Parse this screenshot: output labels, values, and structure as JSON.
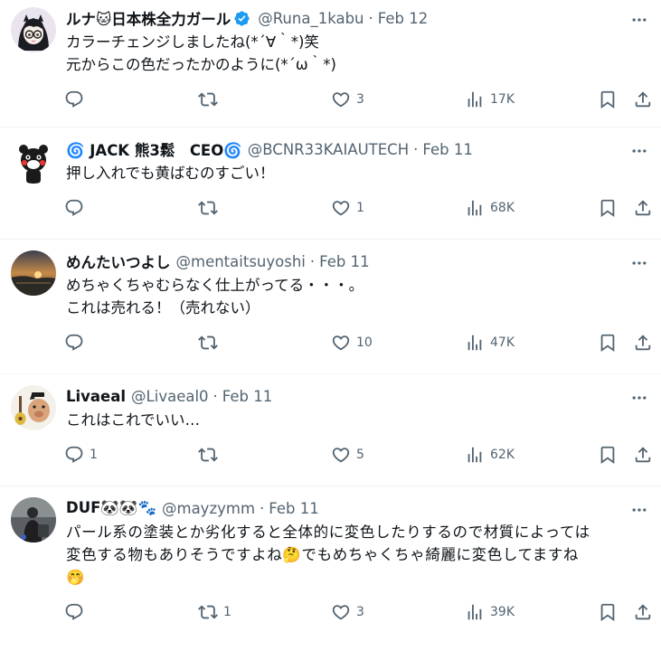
{
  "tweets": [
    {
      "name": "ルナ🐱日本株全力ガール",
      "verified": true,
      "handle": "@Runa_1kabu",
      "date": "Feb 12",
      "lines": [
        "カラーチェンジしましたね(*´∀｀*)笑",
        "元からこの色だったかのように(*´ω｀*)"
      ],
      "replies": "",
      "retweets": "",
      "likes": "3",
      "views": "17K",
      "avatar_icon": "girl-glasses-avatar"
    },
    {
      "name": "🌀 JACK 熊3鬆　CEO🌀",
      "verified": false,
      "handle": "@BCNR33KAIAUTECH",
      "date": "Feb 11",
      "lines": [
        "押し入れでも黄ばむのすごい！"
      ],
      "replies": "",
      "retweets": "",
      "likes": "1",
      "views": "68K",
      "avatar_icon": "bear-mascot-avatar"
    },
    {
      "name": "めんたいつよし",
      "verified": false,
      "handle": "@mentaitsuyoshi",
      "date": "Feb 11",
      "lines": [
        "めちゃくちゃむらなく仕上がってる・・・。",
        "これは売れる！（売れない）"
      ],
      "replies": "",
      "retweets": "",
      "likes": "10",
      "views": "47K",
      "avatar_icon": "sunset-avatar"
    },
    {
      "name": "Livaeal",
      "verified": false,
      "handle": "@Livaeal0",
      "date": "Feb 11",
      "lines": [
        "これはこれでいい…"
      ],
      "replies": "1",
      "retweets": "",
      "likes": "5",
      "views": "62K",
      "avatar_icon": "pig-guitar-avatar"
    },
    {
      "name": "DUF🐼🐼🐾",
      "verified": false,
      "handle": "@mayzymm",
      "date": "Feb 11",
      "lines": [
        "パール系の塗装とか劣化すると全体的に変色したりするので材質によっては",
        "変色する物もありそうですよね🤔でもめちゃくちゃ綺麗に変色してますね",
        "🤭"
      ],
      "replies": "",
      "retweets": "1",
      "likes": "3",
      "views": "39K",
      "avatar_icon": "person-photo-avatar"
    }
  ],
  "colors": {
    "text": "#0f1419",
    "muted": "#536471",
    "divider": "#eff3f4",
    "verified": "#1d9bf0"
  }
}
